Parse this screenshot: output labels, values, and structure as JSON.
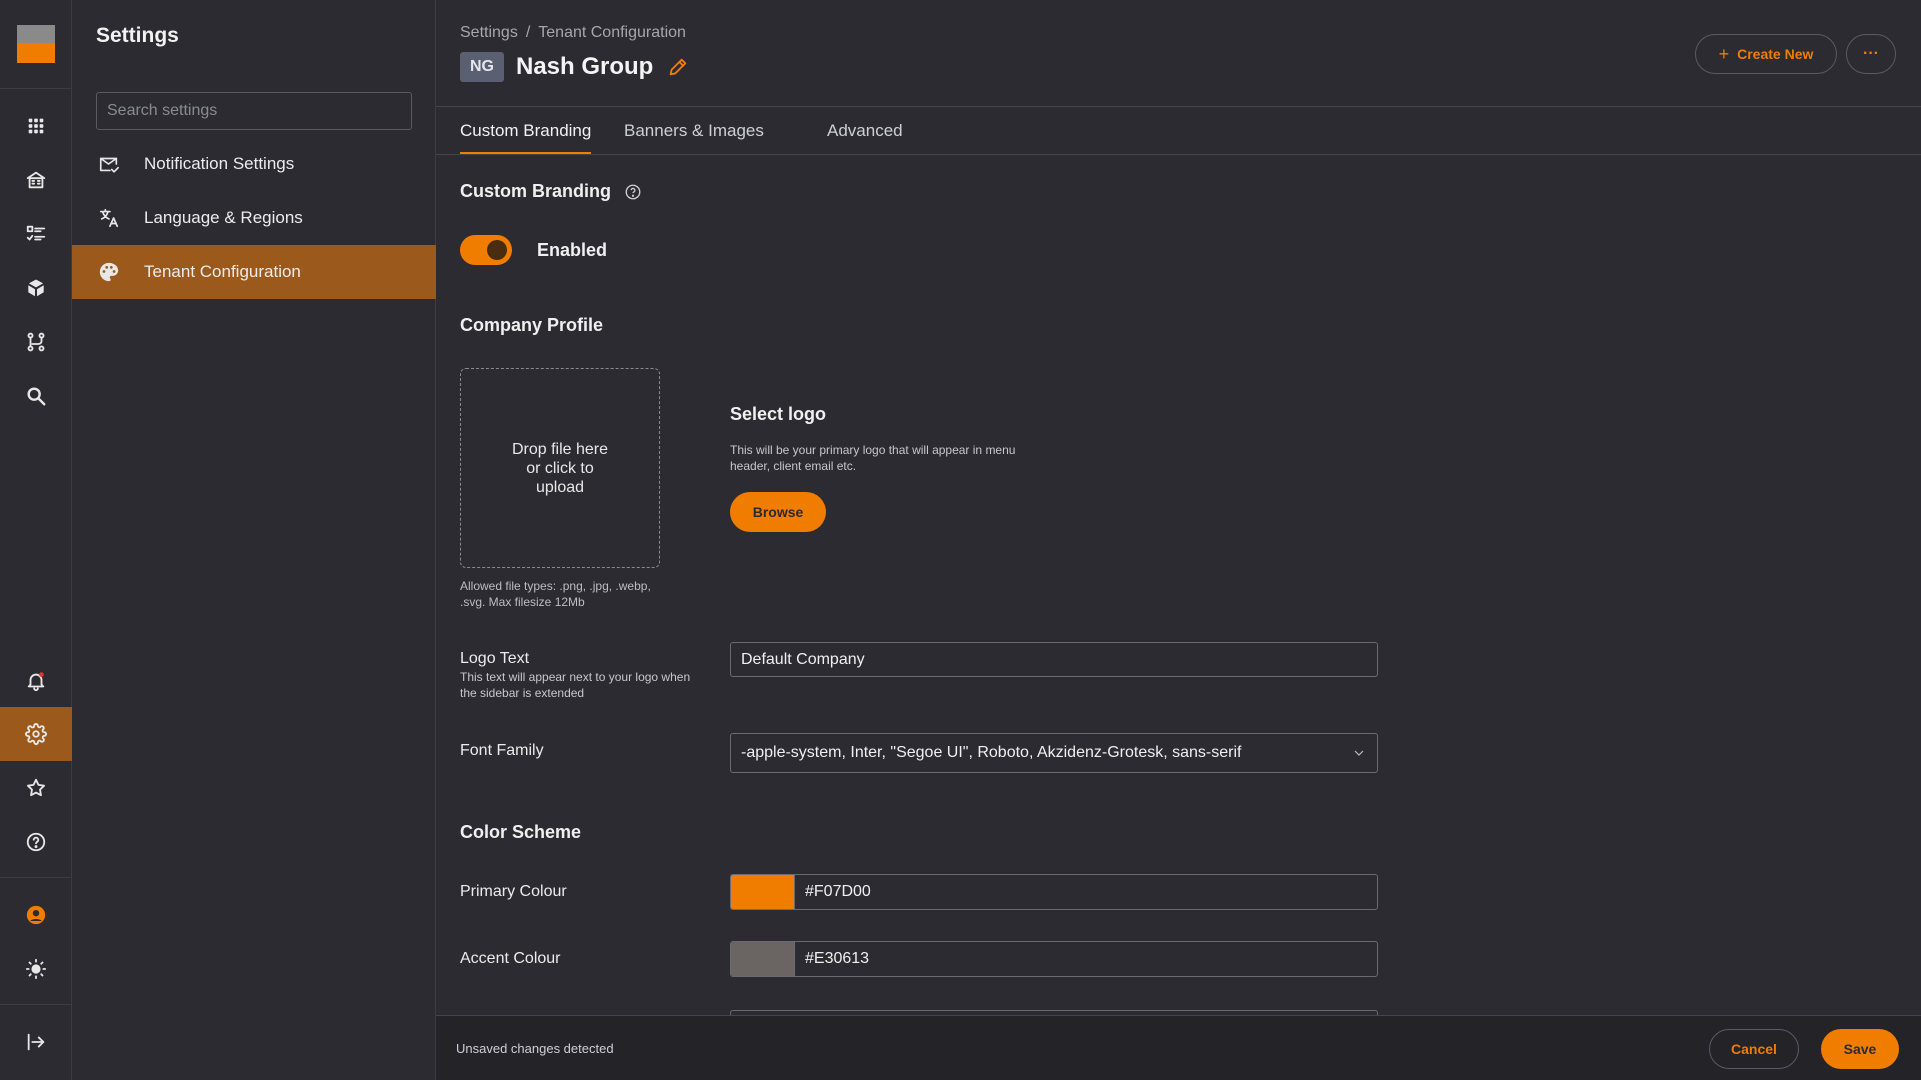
{
  "rail": {
    "logo_colors": {
      "top": "#8a8a8a",
      "bottom": "#f07d00"
    },
    "top_icons": [
      "apps-grid-icon",
      "building-icon",
      "checklist-icon",
      "cube-icon",
      "workflow-icon",
      "search-icon"
    ],
    "bottom_icons": [
      "notification-bell-icon",
      "settings-gear-icon",
      "star-icon",
      "help-circle-icon",
      "user-avatar-icon",
      "theme-sun-icon",
      "logout-icon"
    ],
    "active": "settings-gear-icon",
    "notification_dot_color": "#e5342a"
  },
  "panel": {
    "title": "Settings",
    "search_placeholder": "Search settings",
    "items": [
      {
        "label": "Notification Settings",
        "icon": "mail-check-icon",
        "active": false
      },
      {
        "label": "Language & Regions",
        "icon": "translate-icon",
        "active": false
      },
      {
        "label": "Tenant Configuration",
        "icon": "palette-icon",
        "active": true
      }
    ]
  },
  "header": {
    "breadcrumb": [
      "Settings",
      "/",
      "Tenant Configuration"
    ],
    "badge": "NG",
    "title": "Nash Group",
    "create_label": "Create New",
    "more_label": "···"
  },
  "tabs": [
    {
      "label": "Custom Branding",
      "active": true
    },
    {
      "label": "Banners & Images",
      "active": false
    },
    {
      "label": "Advanced",
      "active": false
    }
  ],
  "branding": {
    "section_title": "Custom Branding",
    "toggle_label": "Enabled",
    "toggle_on": true
  },
  "company": {
    "section_title": "Company Profile",
    "dropzone_text": "Drop file here or click to upload",
    "dropzone_hint": "Allowed file types: .png, .jpg, .webp, .svg. Max filesize 12Mb",
    "logo_title": "Select logo",
    "logo_desc": "This will be your primary logo that will appear in menu header, client email etc.",
    "browse_label": "Browse",
    "logo_text_label": "Logo Text",
    "logo_text_help": "This text will appear next to your logo when the sidebar is extended",
    "logo_text_value": "Default Company",
    "font_family_label": "Font Family",
    "font_family_value": "-apple-system, Inter, \"Segoe UI\", Roboto, Akzidenz-Grotesk, sans-serif"
  },
  "colors": {
    "section_title": "Color Scheme",
    "primary_label": "Primary Colour",
    "primary_value": "#F07D00",
    "primary_swatch": "#f07d00",
    "accent_label": "Accent Colour",
    "accent_value": "#E30613",
    "accent_swatch": "#6a6462"
  },
  "footer": {
    "message": "Unsaved changes detected",
    "cancel_label": "Cancel",
    "save_label": "Save"
  }
}
